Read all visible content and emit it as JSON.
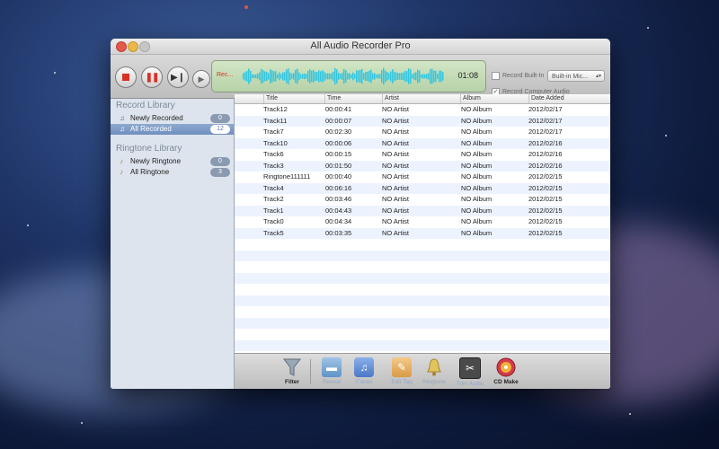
{
  "window": {
    "title": "All Audio Recorder Pro"
  },
  "toolbar": {
    "display_status": "Rec...",
    "display_time": "01:08",
    "record_builtin_label": "Record Built-In",
    "record_builtin_checked": false,
    "input_device": "Built-in Mic...",
    "record_computer_label": "Record Computer Audio",
    "record_computer_checked": true
  },
  "sidebar": {
    "record_header": "Record Library",
    "record_items": [
      {
        "label": "Newly Recorded",
        "count": "0",
        "icon": "music-note-icon"
      },
      {
        "label": "All Recorded",
        "count": "12",
        "icon": "music-note-icon",
        "selected": true
      }
    ],
    "ringtone_header": "Ringtone Library",
    "ringtone_items": [
      {
        "label": "Newly Ringtone",
        "count": "0",
        "icon": "bell-icon"
      },
      {
        "label": "All Ringtone",
        "count": "3",
        "icon": "bell-icon"
      }
    ]
  },
  "table": {
    "columns": [
      "Title",
      "Time",
      "Artist",
      "Album",
      "Date Added"
    ],
    "rows": [
      [
        "Track12",
        "00:00:41",
        "NO Artist",
        "NO Album",
        "2012/02/17"
      ],
      [
        "Track11",
        "00:00:07",
        "NO Artist",
        "NO Album",
        "2012/02/17"
      ],
      [
        "Track7",
        "00:02:30",
        "NO Artist",
        "NO Album",
        "2012/02/17"
      ],
      [
        "Track10",
        "00:00:06",
        "NO Artist",
        "NO Album",
        "2012/02/16"
      ],
      [
        "Track6",
        "00:00:15",
        "NO Artist",
        "NO Album",
        "2012/02/16"
      ],
      [
        "Track3",
        "00:01:50",
        "NO Artist",
        "NO Album",
        "2012/02/16"
      ],
      [
        "Ringtone111111",
        "00:00:40",
        "NO Artist",
        "NO Album",
        "2012/02/15"
      ],
      [
        "Track4",
        "00:06:16",
        "NO Artist",
        "NO Album",
        "2012/02/15"
      ],
      [
        "Track2",
        "00:03:46",
        "NO Artist",
        "NO Album",
        "2012/02/15"
      ],
      [
        "Track1",
        "00:04:43",
        "NO Artist",
        "NO Album",
        "2012/02/15"
      ],
      [
        "Track0",
        "00:04:34",
        "NO Artist",
        "NO Album",
        "2012/02/15"
      ],
      [
        "Track5",
        "00:03:35",
        "NO Artist",
        "NO Album",
        "2012/02/15"
      ]
    ]
  },
  "bottom": {
    "filter": "Filter",
    "reveal": "Reveal",
    "itunes": "iTunes",
    "edit_tag": "Edit Tag",
    "ringtone": "Ringtone",
    "trim_audio": "Trim Audio",
    "cd_make": "CD Make"
  },
  "colors": {
    "accent_red": "#d93025",
    "display_green": "#b7d2a8",
    "wave_cyan": "#35c6e0",
    "selection_blue": "#6f8fbf"
  }
}
